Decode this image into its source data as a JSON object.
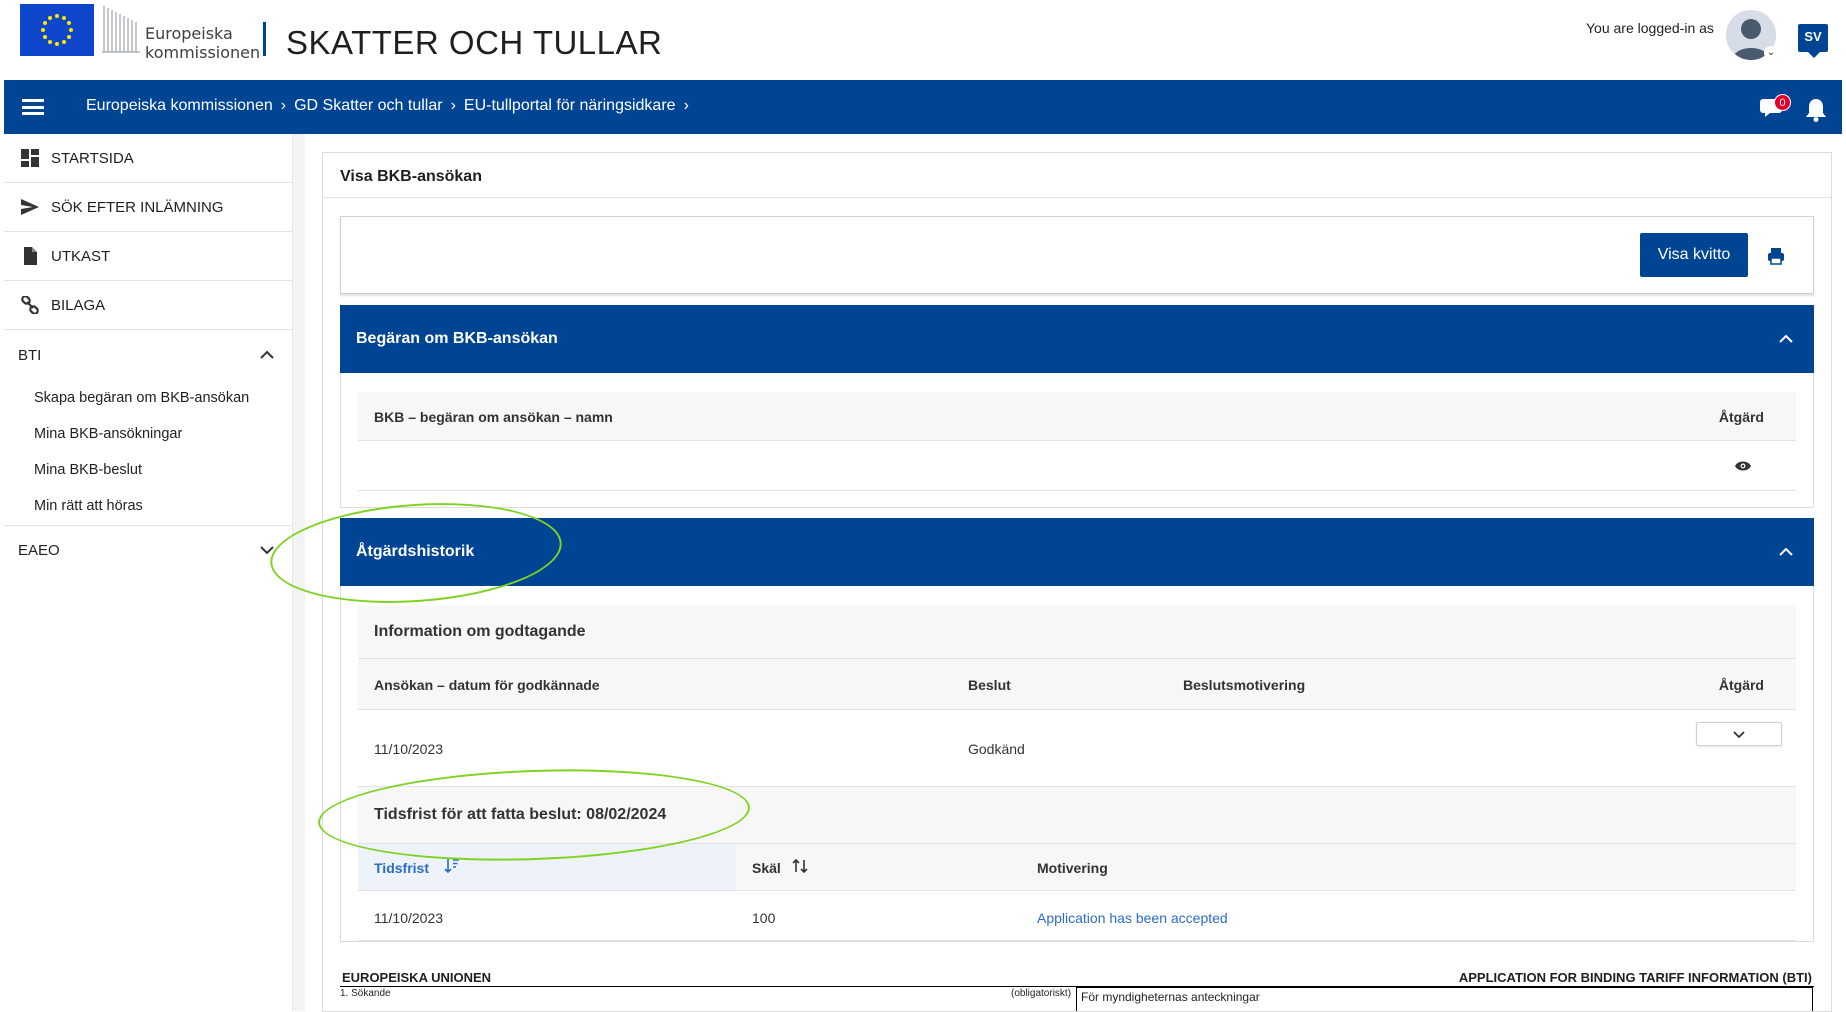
{
  "header": {
    "logo_line1": "Europeiska",
    "logo_line2": "kommissionen",
    "site_title": "SKATTER OCH TULLAR",
    "login_text": "You are logged-in as",
    "language": "SV"
  },
  "nav": {
    "breadcrumbs": [
      "Europeiska kommissionen",
      "GD Skatter och tullar",
      "EU-tullportal för näringsidkare"
    ],
    "notifications_count": "0"
  },
  "sidebar": {
    "items": [
      {
        "label": "STARTSIDA",
        "icon": "dashboard-icon"
      },
      {
        "label": "SÖK EFTER INLÄMNING",
        "icon": "send-icon"
      },
      {
        "label": "UTKAST",
        "icon": "document-icon"
      },
      {
        "label": "BILAGA",
        "icon": "link-icon"
      }
    ],
    "group_bti": "BTI",
    "bti_items": [
      "Skapa begäran om BKB-ansökan",
      "Mina BKB-ansökningar",
      "Mina BKB-beslut",
      "Min rätt att höras"
    ],
    "group_eaeo": "EAEO"
  },
  "main": {
    "page_title": "Visa BKB-ansökan",
    "view_receipt_button": "Visa kvitto",
    "request_section": {
      "title": "Begäran om BKB-ansökan",
      "col_name": "BKB – begäran om ansökan – namn",
      "col_action": "Åtgärd"
    },
    "history_section": {
      "title": "Åtgärdshistorik",
      "approval_title": "Information om godtagande",
      "cols": [
        "Ansökan – datum för godkännade",
        "Beslut",
        "Beslutsmotivering",
        "Åtgärd"
      ],
      "row": {
        "date": "11/10/2023",
        "decision": "Godkänd",
        "motivation": ""
      },
      "deadline_title": "Tidsfrist för att fatta beslut: 08/02/2024",
      "deadline_cols": [
        "Tidsfrist",
        "Skäl",
        "Motivering"
      ],
      "deadline_row": {
        "deadline": "11/10/2023",
        "reason": "100",
        "motivation": "Application has been accepted"
      }
    }
  },
  "form": {
    "left_title": "EUROPEISKA UNIONEN",
    "right_title": "APPLICATION FOR BINDING TARIFF INFORMATION (BTI)",
    "field1": "1. Sökande",
    "field1_note": "(obligatoriskt)",
    "box_label": "För myndigheternas anteckningar"
  },
  "colors": {
    "brand_blue": "#004494",
    "highlight_green": "#7ed321",
    "link_blue": "#2b6cc4",
    "badge_red": "#e0002a"
  }
}
